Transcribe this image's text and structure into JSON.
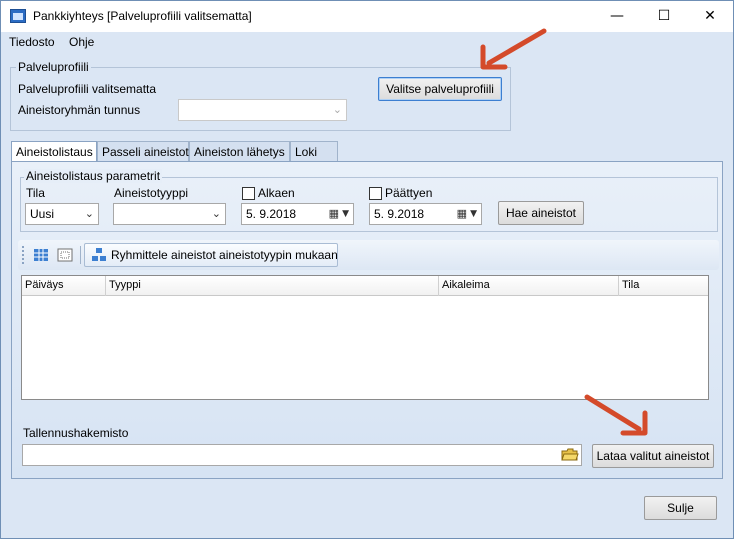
{
  "window": {
    "title": "Pankkiyhteys [Palveluprofiili valitsematta]"
  },
  "window_controls": {
    "minimize": "—",
    "maximize": "☐",
    "close": "✕"
  },
  "menu": {
    "items": [
      "Tiedosto",
      "Ohje"
    ]
  },
  "palveluprofiili": {
    "legend": "Palveluprofiili",
    "status_text": "Palveluprofiili valitsematta",
    "select_button": "Valitse palveluprofiili",
    "group_id_label": "Aineistoryhmän tunnus",
    "group_id_value": ""
  },
  "tabs": [
    {
      "label": "Aineistolistaus",
      "active": true
    },
    {
      "label": "Passeli aineistot",
      "active": false
    },
    {
      "label": "Aineiston lähetys",
      "active": false
    },
    {
      "label": "Loki",
      "active": false
    }
  ],
  "params": {
    "legend": "Aineistolistaus parametrit",
    "tila_label": "Tila",
    "tila_value": "Uusi",
    "tyyppi_label": "Aineistotyyppi",
    "tyyppi_value": "",
    "alkaen_label": "Alkaen",
    "alkaen_checked": false,
    "alkaen_value": "5.  9.2018",
    "paattyen_label": "Päättyen",
    "paattyen_checked": false,
    "paattyen_value": "5.  9.2018",
    "search_button": "Hae aineistot"
  },
  "toolbar": {
    "group_button": "Ryhmittele aineistot aineistotyypin mukaan"
  },
  "table": {
    "columns": [
      "Päiväys",
      "Tyyppi",
      "Aikaleima",
      "Tila"
    ],
    "rows": []
  },
  "save": {
    "label": "Tallennushakemisto",
    "value": "",
    "download_button": "Lataa valitut aineistot"
  },
  "footer": {
    "close_button": "Sulje"
  },
  "colors": {
    "annotation_arrow": "#d44a2a",
    "window_bg": "#dbe6f4"
  }
}
